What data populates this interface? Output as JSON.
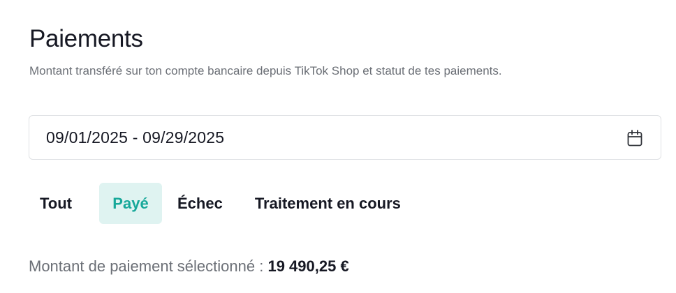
{
  "header": {
    "title": "Paiements",
    "subtitle": "Montant transféré sur ton compte bancaire depuis TikTok Shop et statut de tes paiements."
  },
  "date_range": {
    "value": "09/01/2025 - 09/29/2025",
    "icon": "calendar-icon"
  },
  "tabs": [
    {
      "label": "Tout",
      "active": false
    },
    {
      "label": "Payé",
      "active": true
    },
    {
      "label": "Échec",
      "active": false
    },
    {
      "label": "Traitement en cours",
      "active": false
    }
  ],
  "summary": {
    "label": "Montant de paiement sélectionné : ",
    "value": "19 490,25 €"
  },
  "colors": {
    "accent": "#17a89a",
    "accent_bg": "#dff3f1",
    "text_primary": "#161823",
    "text_secondary": "#6b6f76",
    "border": "#dfe1e4"
  }
}
